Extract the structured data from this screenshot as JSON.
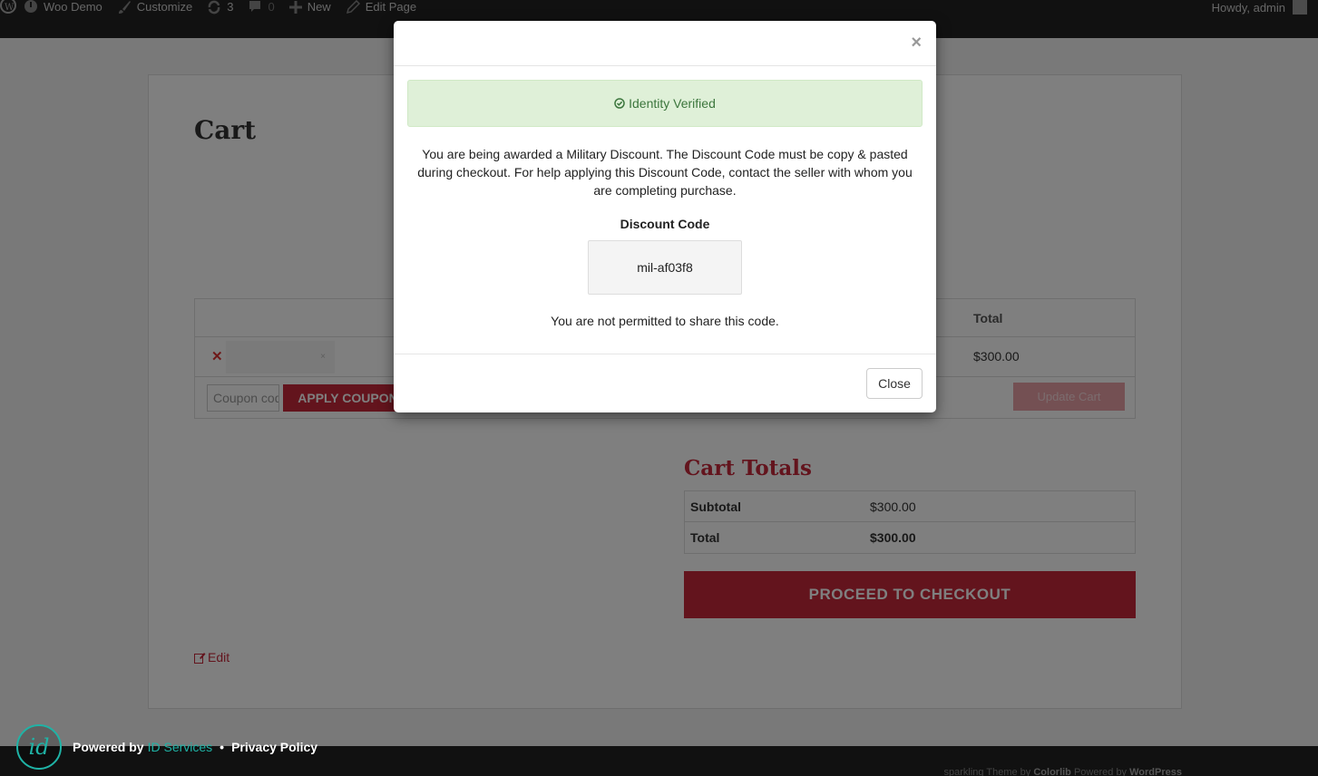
{
  "adminbar": {
    "site_name": "Woo Demo",
    "customize": "Customize",
    "updates_count": "3",
    "comments_count": "0",
    "new_label": "New",
    "edit_page": "Edit Page",
    "howdy": "Howdy, admin"
  },
  "cart": {
    "title": "Cart",
    "header_total": "Total",
    "item_total": "$300.00",
    "coupon_placeholder": "Coupon code",
    "apply_coupon": "APPLY COUPON",
    "update_cart": "Update Cart"
  },
  "totals": {
    "title": "Cart Totals",
    "subtotal_label": "Subtotal",
    "subtotal_value": "$300.00",
    "total_label": "Total",
    "total_value": "$300.00",
    "checkout": "PROCEED TO CHECKOUT"
  },
  "edit_label": "Edit",
  "footer": {
    "theme_text": "sparkling Theme by",
    "theme_author": "Colorlib",
    "powered_text": "Powered by",
    "powered_link": "WordPress"
  },
  "badge": {
    "logo_text": "id",
    "powered_by": "Powered by",
    "service": "ID Services",
    "separator": "•",
    "privacy": "Privacy Policy",
    "accent": "#1fb3a6"
  },
  "modal": {
    "close_x": "×",
    "alert_text": "Identity Verified",
    "message": "You are being awarded a Military Discount. The Discount Code must be copy & pasted during checkout. For help applying this Discount Code, contact the seller with whom you are completing purchase.",
    "code_label": "Discount Code",
    "code_value": "mil-af03f8",
    "note": "You are not permitted to share this code.",
    "close_button": "Close"
  },
  "colors": {
    "brand_red": "#c7283b",
    "success_bg": "#dff0d8",
    "success_text": "#3c763d"
  }
}
